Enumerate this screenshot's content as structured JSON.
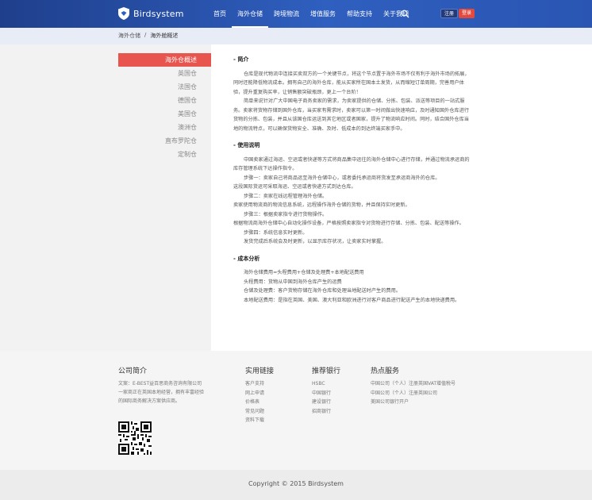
{
  "header": {
    "logo_text": "Birdsystem",
    "nav": [
      "首页",
      "海外仓储",
      "跨境物流",
      "增值服务",
      "帮助支持",
      "关于我们"
    ],
    "active_nav": 1,
    "register_label": "注册",
    "login_label": "登录",
    "accent": "#2f5fbf"
  },
  "breadcrumb": {
    "parent": "海外仓储",
    "separator": "/",
    "current": "海外舱概述"
  },
  "sidebar": {
    "items": [
      "海外仓概述",
      "英国仓",
      "法国仓",
      "德国仓",
      "美国仓",
      "澳洲仓",
      "直布罗陀仓",
      "定制仓"
    ],
    "active_index": 0,
    "active_color": "#e8554e"
  },
  "content": {
    "intro": {
      "title": "- 简介",
      "p1": "仓库是现代物流中连接买卖双方的一个关键节点，将这个节点置于海外市场不仅有利于海外市场的拓展，同时还能降低物流成本。拥有自己的海外仓库，能从买家所在国本土发货，从而缩短订单周期，完善用户体验，提升重复购买率，让销售额突破瓶颈，更上一个台阶！",
      "p2": "简单来说针对广大中国电子商务卖家的需求，为卖家提供的仓储、分拣、包装、派送等项目的一站式服务。卖家将货物存储到国外仓库，当买家有需求时，卖家可以第一时间做出快速响应，及时通知国外仓库进行货物的分拣、包装，并且从该国仓库运送到其它地区或者国家，提升了物流响应时间。同时，结合国外仓库当地的物流特点，可以确保货物安全、准确、及时、低成本的到达终端买家手中。"
    },
    "usage": {
      "title": "- 使用说明",
      "p1": "中国卖家通过海运、空运或者快递等方式将商品集中运往的海外仓储中心进行存储，并通过物流承运商的库存管理系统下达操作指令。",
      "s1": "步骤一：卖家自己将商品运至海外仓储中心，或者委托承运商将货发至承运商海外的仓库。",
      "s1b": "这段国际货运可采取海运、空运或者快递方式到达仓库。",
      "s2": "步骤二：卖家在线远程管理海外仓储。",
      "s2b": "卖家使用物流商的物流信息系统，远程操作海外仓储的货物，并且保持实时更新。",
      "s3": "步骤三：根据卖家指令进行货物操作。",
      "s3b": "根据物流商海外仓储中心自动化操作设备，严格按照卖家指令对货物进行存储、分拣、包装、配送等操作。",
      "s4": "步骤四：系统信息实时更新。",
      "s4b": "发货完成后系统会及时更新，以显示库存状况，让卖家实时掌握。"
    },
    "cost": {
      "title": "- 成本分析",
      "l1": "海外仓储费用=头程费用+仓储及处理费+本地配送费用",
      "l2": "头程费用：货物从中国到海外仓库产生的运费",
      "l3": "仓储及处理费：客户货物存储在海外仓库和处理当地配送时产生的费用。",
      "l4": "本地配送费用：是指在英国、美国、澳大利亚和欧洲进行对客户商品进行配送产生的本地快递费用。"
    }
  },
  "footer": {
    "company": {
      "title": "公司简介",
      "text": "文案：E-BEST益百思商务咨询有限公司一家商正在英国本地经营，拥有丰富经验的国际商务解决方案供应商。"
    },
    "links": {
      "title": "实用链接",
      "items": [
        "客户支持",
        "网上申请",
        "价格表",
        "常见问题",
        "资料下载"
      ]
    },
    "banks": {
      "title": "推荐银行",
      "items": [
        "HSBC",
        "中国银行",
        "建设银行",
        "招商银行"
      ]
    },
    "services": {
      "title": "热点服务",
      "items": [
        "中国公司（个人）注册英国VAT增值税号",
        "中国公司（个人）注册英国公司",
        "美国公司银行开户"
      ]
    },
    "copyright": "Copyright © 2015 Birdsystem"
  }
}
